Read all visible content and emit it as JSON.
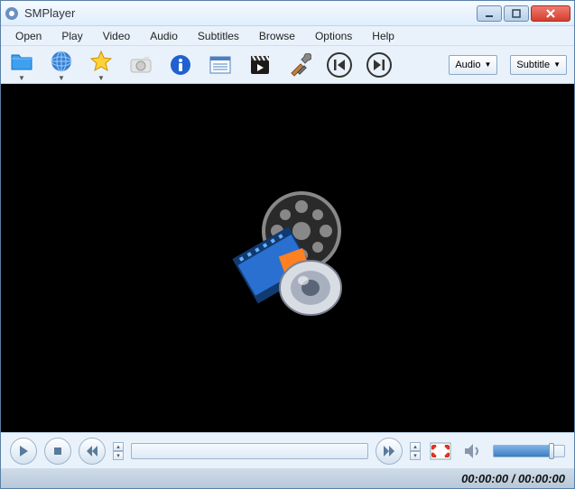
{
  "window": {
    "title": "SMPlayer"
  },
  "menu": {
    "items": [
      "Open",
      "Play",
      "Video",
      "Audio",
      "Subtitles",
      "Browse",
      "Options",
      "Help"
    ]
  },
  "toolbar": {
    "audio_selector": "Audio",
    "subtitle_selector": "Subtitle"
  },
  "status": {
    "time": "00:00:00 / 00:00:00"
  },
  "playback": {
    "volume_percent": 80
  }
}
